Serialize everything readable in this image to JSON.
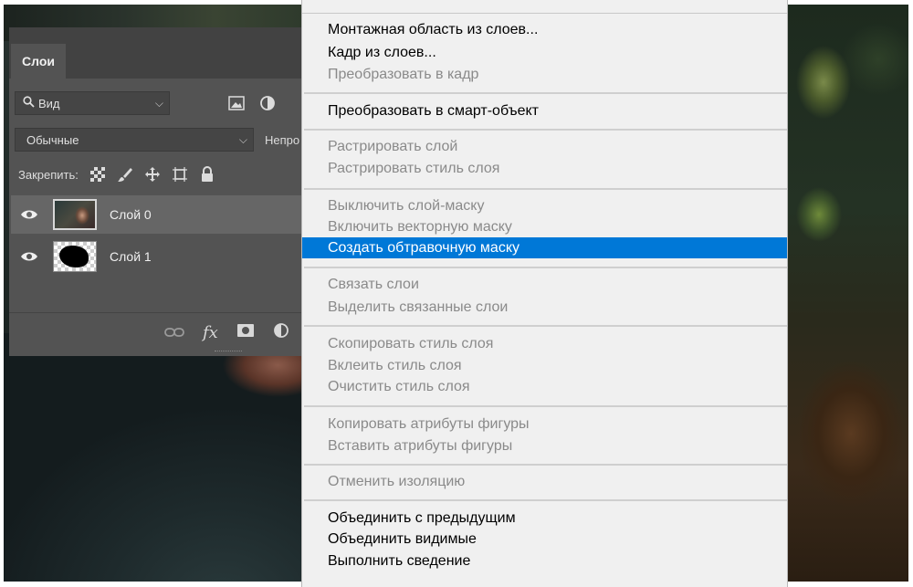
{
  "layers_panel": {
    "tab_label": "Слои",
    "filter_kind": "Вид",
    "blend_mode": "Обычные",
    "opacity_label": "Непро",
    "lock_label": "Закрепить:",
    "layers": [
      {
        "name": "Слой 0",
        "selected": true
      },
      {
        "name": "Слой 1",
        "selected": false
      }
    ],
    "footer_fx": "fx"
  },
  "context_menu": {
    "highlight_color": "#0078d7",
    "items": [
      {
        "label": "Монтажная область из слоев...",
        "enabled": true
      },
      {
        "label": "Кадр из слоев...",
        "enabled": true
      },
      {
        "label": "Преобразовать в кадр",
        "enabled": false
      },
      {
        "label": "Преобразовать в смарт-объект",
        "enabled": true
      },
      {
        "label": "Растрировать слой",
        "enabled": false
      },
      {
        "label": "Растрировать стиль слоя",
        "enabled": false
      },
      {
        "label": "Выключить слой-маску",
        "enabled": false
      },
      {
        "label": "Включить векторную маску",
        "enabled": false
      },
      {
        "label": "Создать обтравочную маску",
        "enabled": true,
        "highlighted": true
      },
      {
        "label": "Связать слои",
        "enabled": false
      },
      {
        "label": "Выделить связанные слои",
        "enabled": false
      },
      {
        "label": "Скопировать стиль слоя",
        "enabled": false
      },
      {
        "label": "Вклеить стиль слоя",
        "enabled": false
      },
      {
        "label": "Очистить стиль слоя",
        "enabled": false
      },
      {
        "label": "Копировать атрибуты фигуры",
        "enabled": false
      },
      {
        "label": "Вставить атрибуты фигуры",
        "enabled": false
      },
      {
        "label": "Отменить изоляцию",
        "enabled": false
      },
      {
        "label": "Объединить с предыдущим",
        "enabled": true
      },
      {
        "label": "Объединить видимые",
        "enabled": true
      },
      {
        "label": "Выполнить сведение",
        "enabled": true
      }
    ]
  }
}
